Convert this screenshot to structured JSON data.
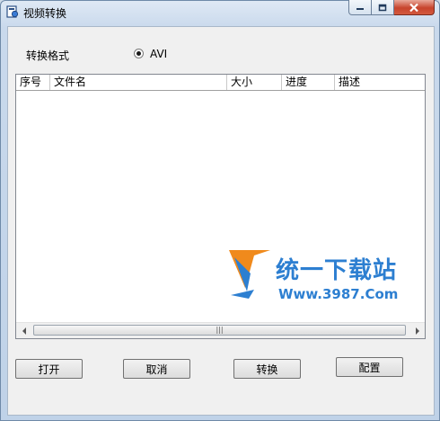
{
  "window": {
    "title": "视频转换",
    "icon": "video-convert-app-icon",
    "controls": [
      "minimize-icon",
      "maximize-icon",
      "close-icon"
    ]
  },
  "format": {
    "label": "转换格式",
    "option": "AVI",
    "selected": true
  },
  "file_list": {
    "columns": [
      "序号",
      "文件名",
      "大小",
      "进度",
      "描述"
    ],
    "rows": []
  },
  "buttons": {
    "open": "打开",
    "cancel": "取消",
    "convert": "转换",
    "config": "配置"
  },
  "watermark": {
    "text": "统一下载站",
    "url": "Www.3987.Com"
  },
  "colors": {
    "close_button": "#c7442d",
    "watermark": "#2d7fd1",
    "dialog_bg": "#f0f0f0"
  }
}
